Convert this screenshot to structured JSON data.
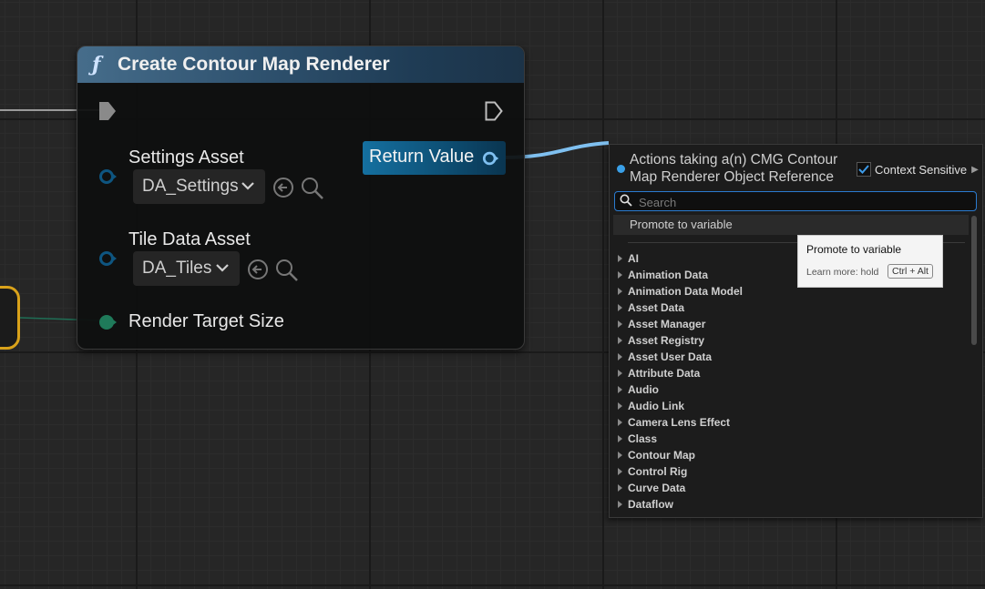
{
  "node": {
    "title": "Create Contour Map Renderer",
    "func_icon": "ƒ",
    "pins": {
      "settings_label": "Settings Asset",
      "settings_value": "DA_Settings",
      "tile_label": "Tile Data Asset",
      "tile_value": "DA_Tiles",
      "render_label": "Render Target Size",
      "return_label": "Return Value"
    }
  },
  "menu": {
    "title": "Actions taking a(n) CMG Contour Map Renderer Object Reference",
    "context_label": "Context Sensitive",
    "context_checked": true,
    "search_placeholder": "Search",
    "promote_label": "Promote to variable",
    "categories": [
      "AI",
      "Animation Data",
      "Animation Data Model",
      "Asset Data",
      "Asset Manager",
      "Asset Registry",
      "Asset User Data",
      "Attribute Data",
      "Audio",
      "Audio Link",
      "Camera Lens Effect",
      "Class",
      "Contour Map",
      "Control Rig",
      "Curve Data",
      "Dataflow"
    ]
  },
  "tooltip": {
    "title": "Promote to variable",
    "learn": "Learn more: hold",
    "keys": "Ctrl + Alt"
  },
  "colors": {
    "header_blue": "#466d8b",
    "object_pin": "#1aa0e0",
    "struct_pin": "#1f7a5a",
    "wire": "#7fc0f0",
    "reroute": "#d9a21a"
  }
}
